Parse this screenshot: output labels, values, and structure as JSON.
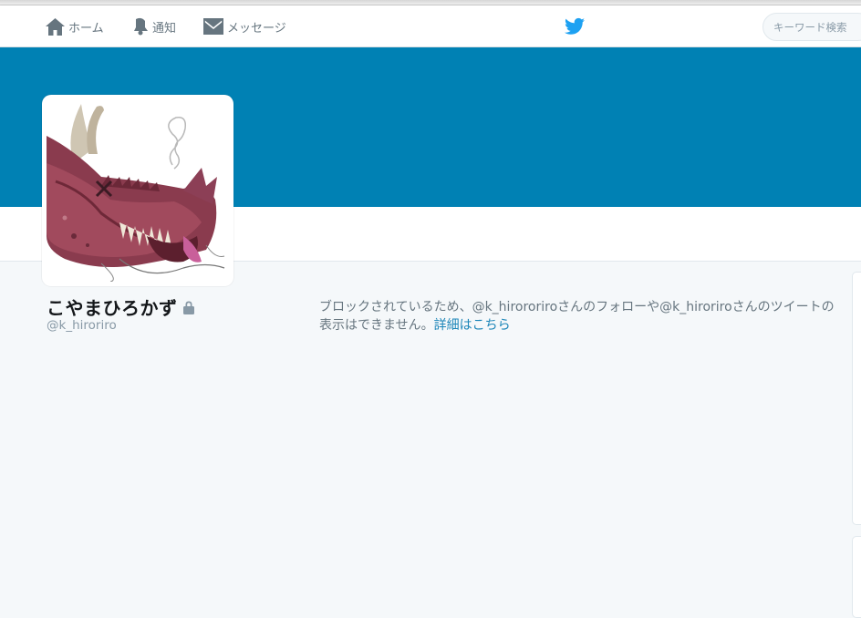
{
  "nav": {
    "home_label": "ホーム",
    "notifications_label": "通知",
    "messages_label": "メッセージ",
    "search_placeholder": "キーワード検索"
  },
  "profile": {
    "full_name": "こやまひろかず",
    "handle": "@k_hiroriro",
    "protected": true
  },
  "blocked_notice": {
    "text": "ブロックされているため、@k_hirororiroさんのフォローや@k_hiroriroさんのツイートの表示はできません。",
    "link_text": "詳細はこちら"
  },
  "colors": {
    "banner": "#0081b4",
    "link": "#1b85b8",
    "bird": "#1da1f2",
    "page_background": "#f5f8fa"
  },
  "icons": [
    "home-icon",
    "bell-icon",
    "envelope-icon",
    "twitter-bird-icon",
    "lock-icon"
  ]
}
